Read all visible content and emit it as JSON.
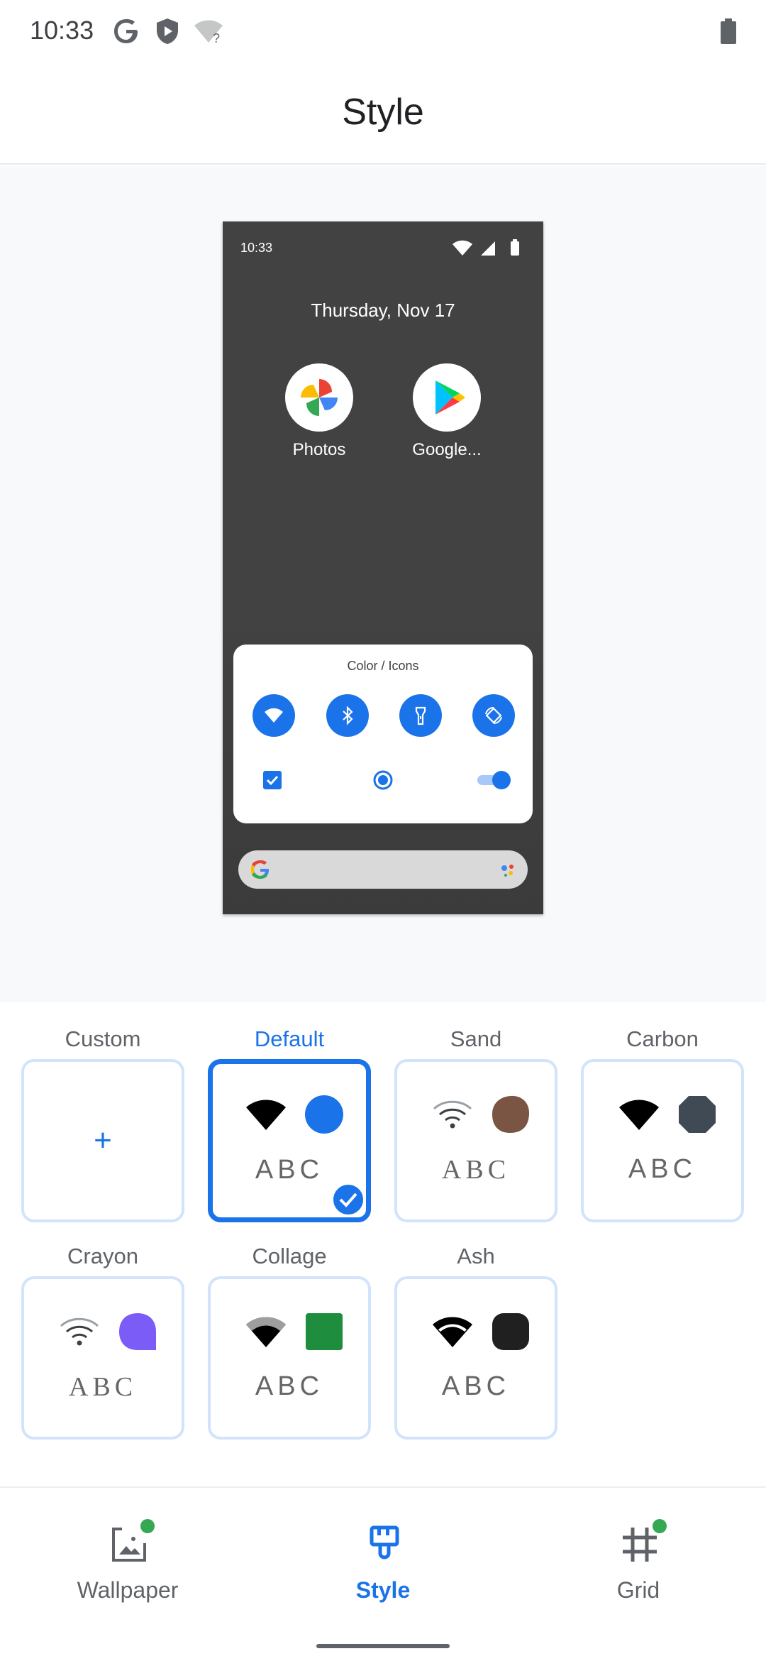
{
  "status_bar": {
    "time": "10:33",
    "icons": [
      "google-g-icon",
      "shield-icon",
      "wifi-unknown-icon",
      "battery-icon"
    ]
  },
  "header": {
    "title": "Style"
  },
  "preview": {
    "time": "10:33",
    "date": "Thursday, Nov 17",
    "apps": [
      {
        "label": "Photos",
        "icon": "photos-pinwheel-icon"
      },
      {
        "label": "Google...",
        "icon": "play-store-icon"
      }
    ],
    "quick_settings_title": "Color / Icons",
    "quick_settings_tiles": [
      "wifi-icon",
      "bluetooth-icon",
      "flashlight-icon",
      "rotate-icon"
    ],
    "controls": [
      "checkbox-checked",
      "radio-selected",
      "switch-on"
    ]
  },
  "styles": {
    "selected": "Default",
    "items": [
      {
        "label": "Custom",
        "kind": "add"
      },
      {
        "label": "Default",
        "abc": "ABC",
        "shape": "circle",
        "color": "#1a73e8",
        "selected": true
      },
      {
        "label": "Sand",
        "abc": "ABC",
        "shape": "blob",
        "color": "#7b5544"
      },
      {
        "label": "Carbon",
        "abc": "ABC",
        "shape": "octagon",
        "color": "#3f4a55"
      },
      {
        "label": "Crayon",
        "abc": "ABC",
        "shape": "teardrop",
        "color": "#7c5cf6"
      },
      {
        "label": "Collage",
        "abc": "ABC",
        "shape": "square",
        "color": "#1e8e3e"
      },
      {
        "label": "Ash",
        "abc": "ABC",
        "shape": "squircle",
        "color": "#202020"
      }
    ]
  },
  "bottom_nav": {
    "items": [
      {
        "label": "Wallpaper",
        "icon": "wallpaper-icon",
        "badge": true
      },
      {
        "label": "Style",
        "icon": "paintbrush-icon",
        "active": true
      },
      {
        "label": "Grid",
        "icon": "grid-icon",
        "badge": true
      }
    ]
  },
  "colors": {
    "accent": "#1a73e8",
    "badge": "#34a853",
    "card_border": "#d2e3fc"
  }
}
